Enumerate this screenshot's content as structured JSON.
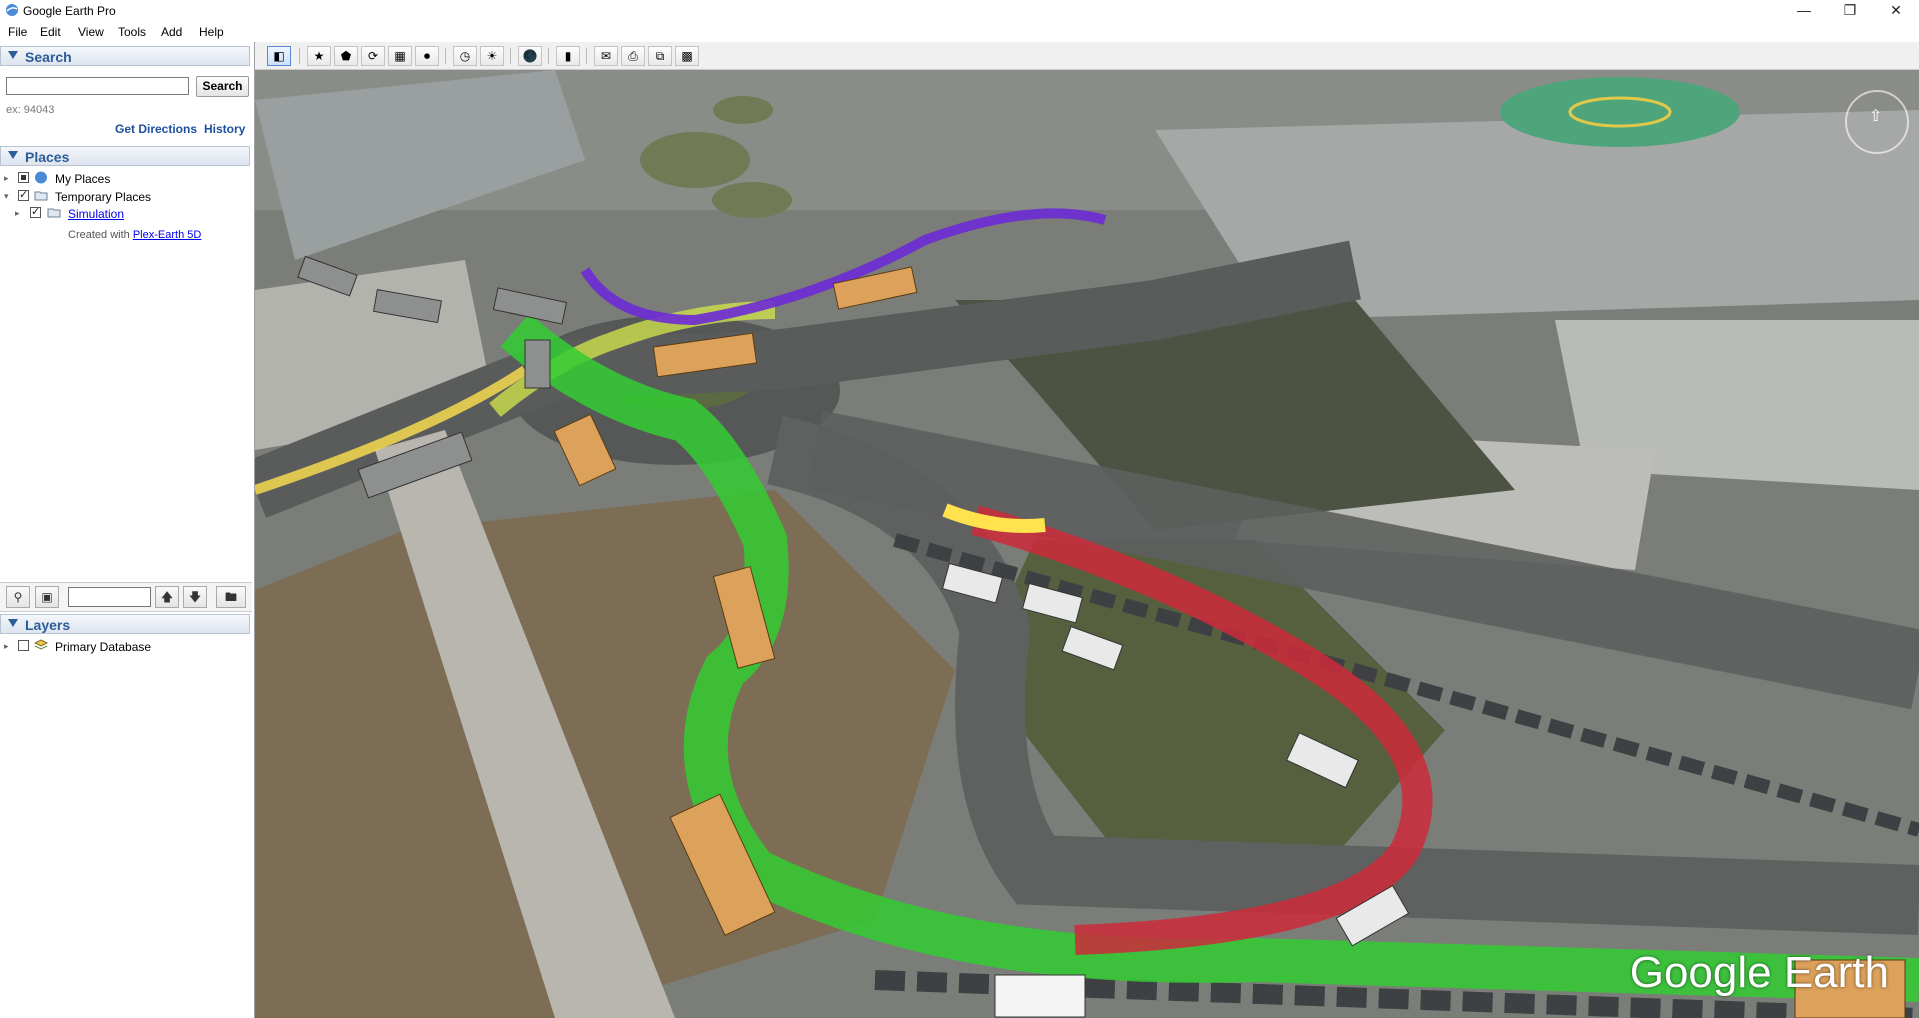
{
  "window": {
    "title": "Google Earth Pro"
  },
  "menu": [
    "File",
    "Edit",
    "View",
    "Tools",
    "Add",
    "Help"
  ],
  "search": {
    "header": "Search",
    "placeholder": "",
    "button": "Search",
    "hint": "ex: 94043",
    "get_directions": "Get Directions",
    "history": "History"
  },
  "places": {
    "header": "Places",
    "my_places": "My Places",
    "temporary_places": "Temporary Places",
    "simulation": "Simulation",
    "created_with": "Created with",
    "plex_link": "Plex-Earth 5D"
  },
  "layers": {
    "header": "Layers",
    "primary_database": "Primary Database"
  },
  "map": {
    "watermark": "Google Earth"
  },
  "colors": {
    "panel_header_text": "#2d5c97",
    "link": "#1d4f9e",
    "path_green": "#33cc33",
    "path_red": "#cc2a3a",
    "path_purple": "#6d2ad6",
    "path_yellow": "#ffe24d"
  }
}
